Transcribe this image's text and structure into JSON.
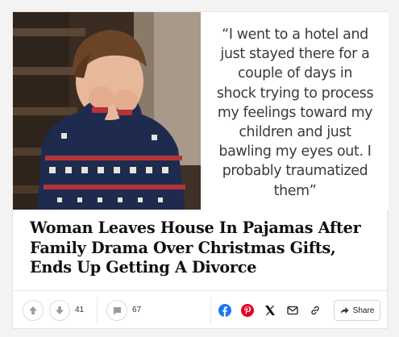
{
  "post": {
    "quote_lines": [
      "“I went to a hotel and",
      "just stayed there for a",
      "couple of days in",
      "shock trying to process",
      "my feelings toward my",
      "children and just",
      "bawling my eyes out. I",
      "probably traumatized",
      "them”"
    ],
    "title_lines": [
      "Woman Leaves House In Pajamas After",
      "Family Drama Over Christmas Gifts,",
      "Ends Up Getting A Divorce"
    ]
  },
  "actions": {
    "vote_count": "41",
    "comment_count": "67",
    "share_label": "Share",
    "icons": [
      "upvote-icon",
      "downvote-icon",
      "comment-icon",
      "facebook-icon",
      "pinterest-icon",
      "x-icon",
      "email-icon",
      "link-icon",
      "share-arrow-icon"
    ]
  },
  "colors": {
    "facebook": "#1877f2",
    "pinterest": "#e60023",
    "icon_gray": "#9b9b9b"
  }
}
